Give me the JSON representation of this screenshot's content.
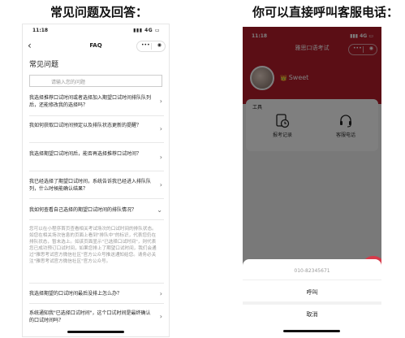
{
  "headings": {
    "left": "常见问题及回答：",
    "right": "你可以直接呼叫客服电话："
  },
  "left_phone": {
    "status": {
      "time": "11:18",
      "signal": "4G"
    },
    "nav": {
      "back": "‹",
      "title": "FAQ",
      "menu": "•••",
      "target": "◉"
    },
    "page_title": "常见问题",
    "search_placeholder": "请输入您的问题",
    "faqs": [
      {
        "q": "我选择推荐口试时间或者选择加入期望口试时间排队队列后，还能修改我的选择吗？",
        "chev": "›"
      },
      {
        "q": "我如何获取口试时间预定以及排队状态更新的提醒？",
        "chev": "›"
      },
      {
        "q": "我选择期望口试时间后，能否再选择推荐口试时间？",
        "chev": "›"
      },
      {
        "q": "我已经选择了期望口试时间，系统告诉我已经进入排队队列，什么时候能确认结果？",
        "chev": "›"
      },
      {
        "q": "我如何查看自己选择的期望口试时间的排队情况？",
        "chev": "⌄"
      }
    ],
    "answer": "您可以在小程序首页查看相关考试场次的口试时间的排队状态。如您在相关场次信息的页面上看到\"排队中\"的标识，代表您仍在排队状态，暂未选上。如该页面显示\"已选择口试时间\"，则代表您已成功预订口试时间，如果您排上了期望口试时间，我们会通过\"雅思考试官方微信社区\"官方公众号推送通知给您。请务必关注\"雅思考试官方微信社区\"官方公众号。",
    "faqs_bottom": [
      {
        "q": "我选择期望的口试时间最后没排上怎么办？",
        "chev": "›"
      },
      {
        "q": "系统通知我\"已选择口试时间\"，这个口试时间是最终确认的口试时间吗？",
        "chev": "›"
      }
    ]
  },
  "right_phone": {
    "status": {
      "time": "11:18",
      "signal": "4G"
    },
    "nav": {
      "title": "雅思口语考试",
      "menu": "•••",
      "target": "◉"
    },
    "user": {
      "vip": "👑",
      "name": "Sweet"
    },
    "tools": {
      "title": "工具",
      "items": [
        {
          "label": "报考记录",
          "icon": "clock-document-icon"
        },
        {
          "label": "客服电话",
          "icon": "headset-icon"
        }
      ]
    },
    "sheet": {
      "phone_number": "010-82345671",
      "call": "呼叫",
      "cancel": "取消"
    }
  },
  "colors": {
    "brand_red": "#b71c2b",
    "overlay": "rgba(0,0,0,0.5)"
  }
}
